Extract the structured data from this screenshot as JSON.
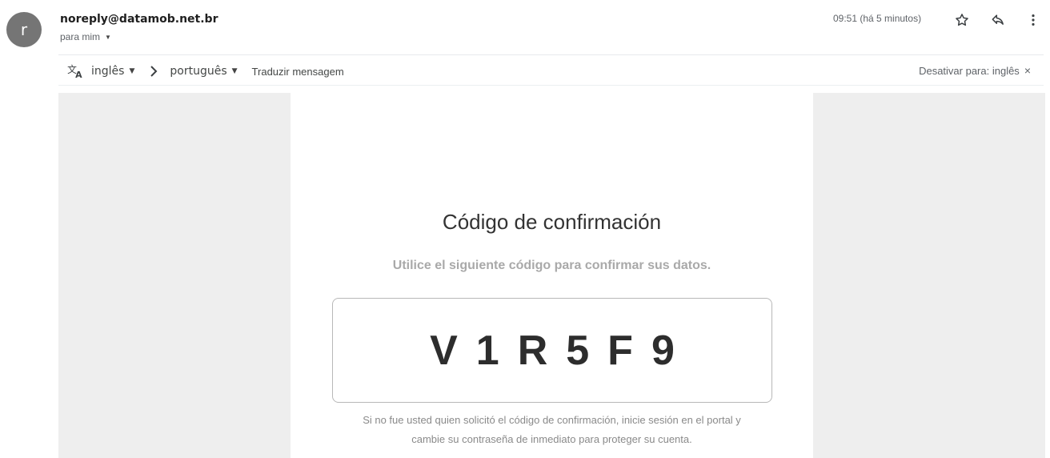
{
  "header": {
    "avatar_letter": "r",
    "avatar_color": "#757575",
    "sender": "noreply@datamob.net.br",
    "recipient": "para mim",
    "time": "09:51 (há 5 minutos)",
    "icons": [
      "star-icon",
      "reply-icon",
      "more-vert-icon"
    ]
  },
  "translate_bar": {
    "source_lang": "inglês",
    "target_lang": "português",
    "translate_link": "Traduzir mensagem",
    "disable_label": "Desativar para: inglês",
    "close_glyph": "×"
  },
  "email": {
    "title": "Código de confirmación",
    "subtitle": "Utilice el siguiente código para confirmar sus datos.",
    "code": "V1R5F9",
    "note_line1": "Si no fue usted quien solicitó el código de confirmación, inicie sesión en el portal y",
    "note_line2": "cambie su contraseña de inmediato para proteger su cuenta."
  },
  "colors": {
    "page_bg": "#ffffff",
    "email_bg": "#eeeeee",
    "subtitle": "#a9a9a9"
  }
}
